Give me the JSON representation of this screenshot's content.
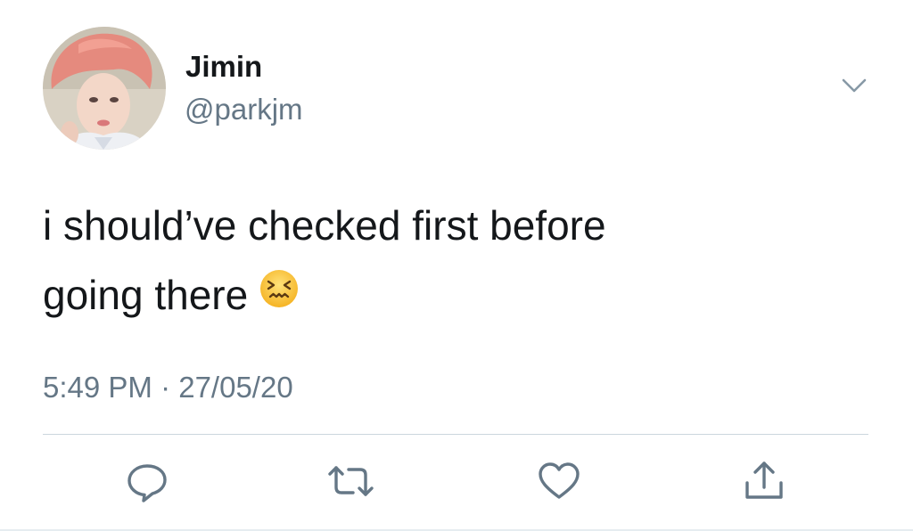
{
  "tweet": {
    "user": {
      "display_name": "Jimin",
      "handle": "@parkjm",
      "avatar": "profile-photo"
    },
    "text_lines": [
      "i should’ve checked first before",
      "going there"
    ],
    "emoji": "confounded-face-emoji",
    "timestamp": "5:49 PM · 27/05/20",
    "actions": [
      "reply-icon",
      "retweet-icon",
      "like-icon",
      "share-icon"
    ],
    "colors": {
      "text": "#14171a",
      "secondary": "#657786",
      "icon": "#657786",
      "divider": "#ccd6dd"
    }
  }
}
